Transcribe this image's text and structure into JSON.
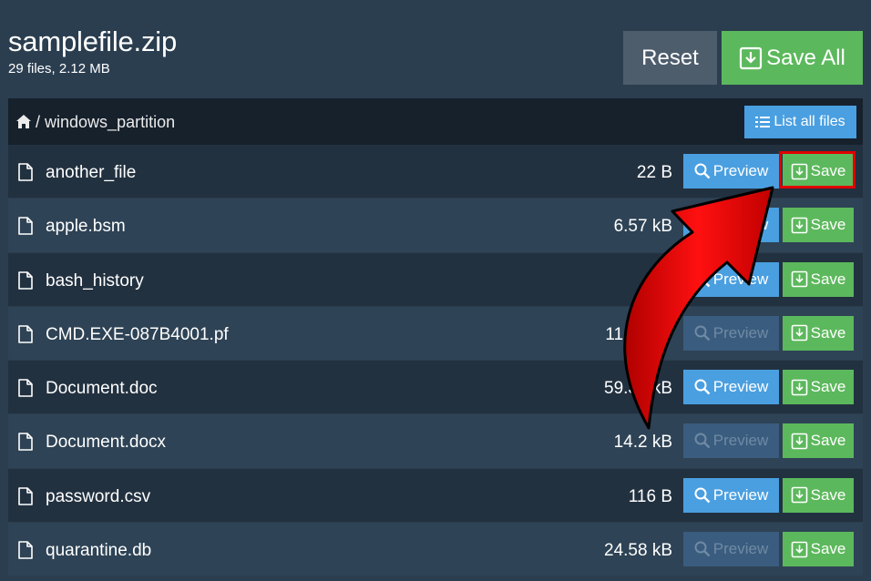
{
  "header": {
    "title": "samplefile.zip",
    "subtitle": "29 files, 2.12 MB",
    "reset_label": "Reset",
    "save_all_label": "Save All"
  },
  "breadcrumb": {
    "separator": "/",
    "path": "windows_partition",
    "list_all_label": "List all files"
  },
  "labels": {
    "preview": "Preview",
    "save": "Save"
  },
  "files": [
    {
      "name": "another_file",
      "size": "22 B",
      "preview_enabled": true
    },
    {
      "name": "apple.bsm",
      "size": "6.57 kB",
      "preview_enabled": true
    },
    {
      "name": "bash_history",
      "size": "",
      "preview_enabled": true
    },
    {
      "name": "CMD.EXE-087B4001.pf",
      "size": "11.__ kB",
      "preview_enabled": false
    },
    {
      "name": "Document.doc",
      "size": "59.3_ kB",
      "preview_enabled": true
    },
    {
      "name": "Document.docx",
      "size": "14.2 kB",
      "preview_enabled": false
    },
    {
      "name": "password.csv",
      "size": "116 B",
      "preview_enabled": true
    },
    {
      "name": "quarantine.db",
      "size": "24.58 kB",
      "preview_enabled": false
    }
  ],
  "colors": {
    "background": "#2b3e50",
    "primary": "#4a9fe0",
    "success": "#5cb85c",
    "highlight": "#e00000"
  }
}
